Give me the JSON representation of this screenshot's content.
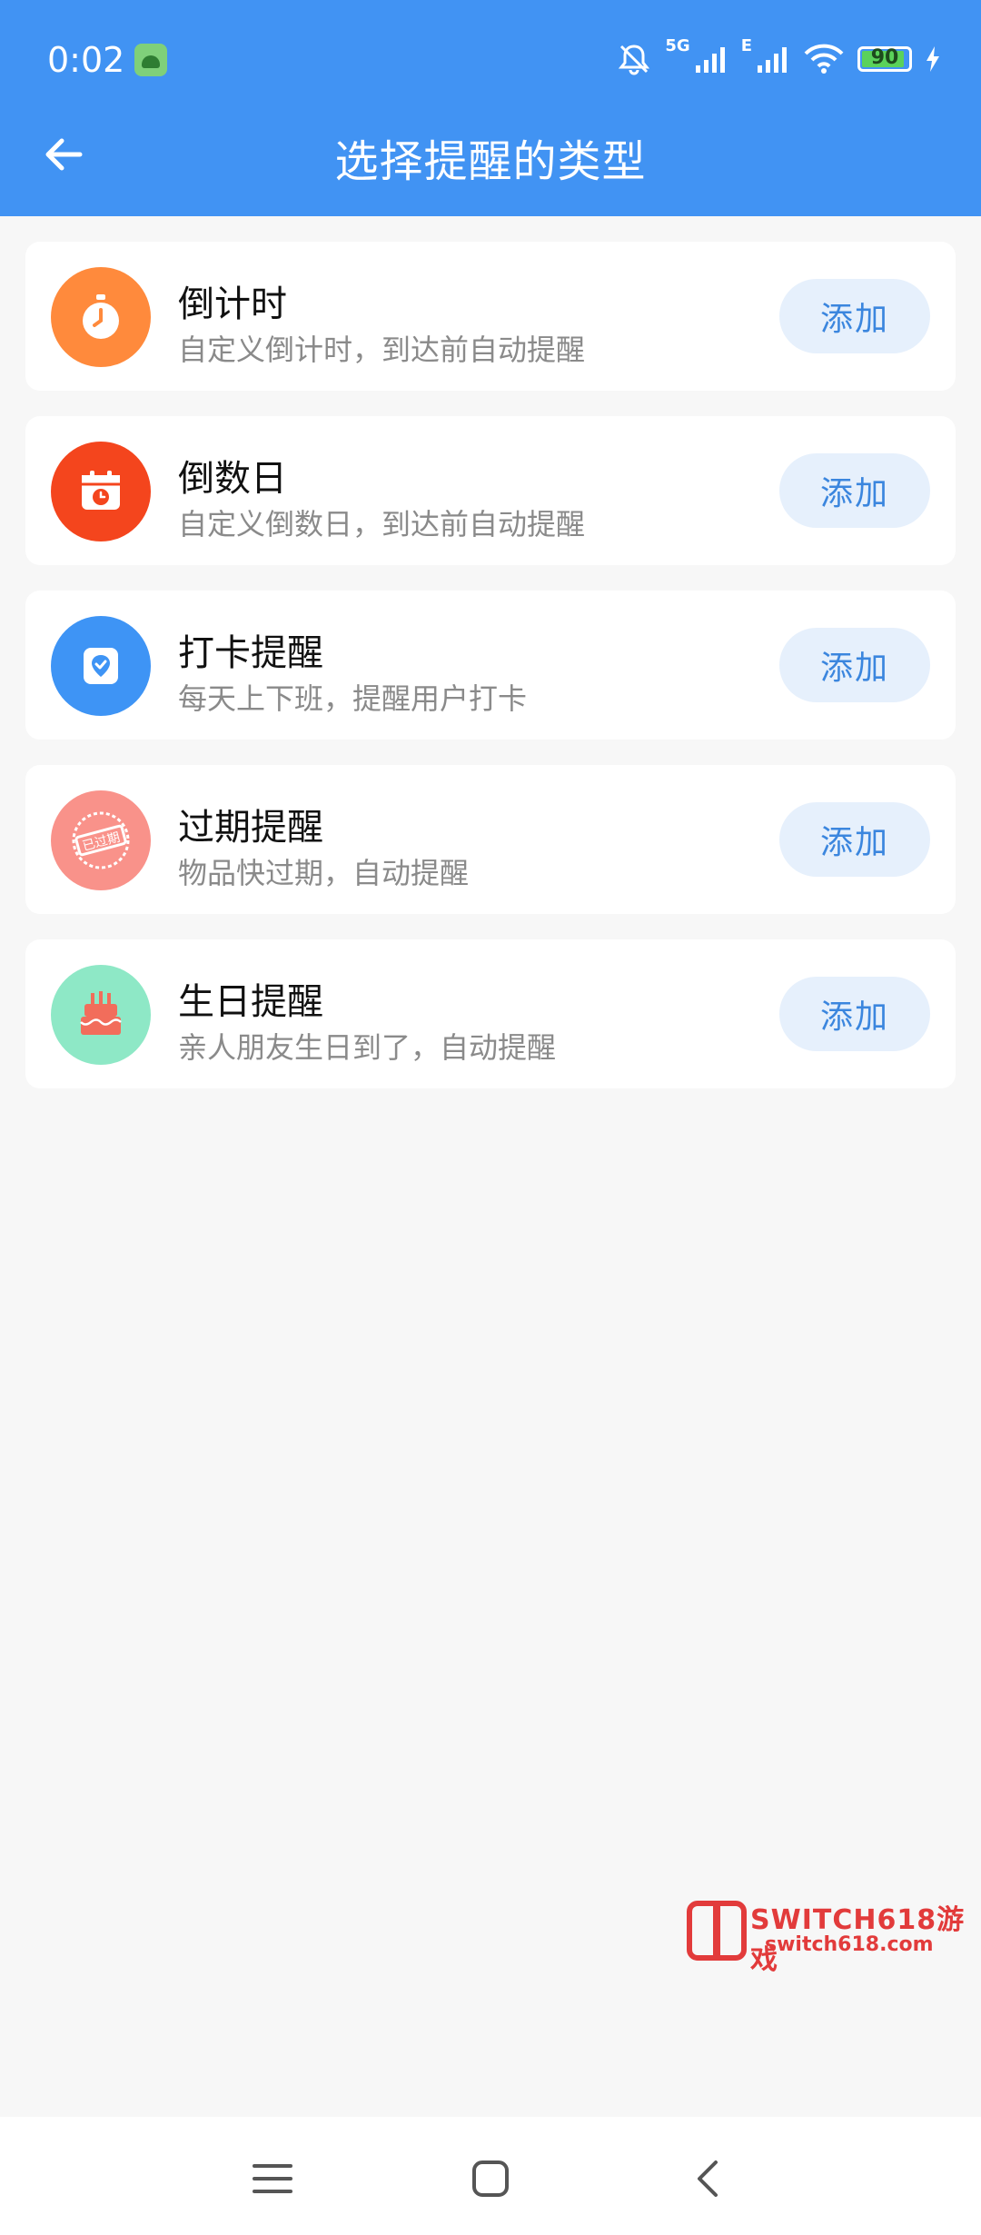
{
  "status_bar": {
    "time": "0:02",
    "network_label": "5G",
    "network2_label": "E",
    "battery": "90",
    "icons": [
      "android-app-icon",
      "bell-muted-icon",
      "signal-icon",
      "wifi-icon",
      "battery-icon",
      "charging-icon"
    ]
  },
  "header": {
    "title": "选择提醒的类型",
    "back_icon": "arrow-left-icon",
    "background": "#4193f3"
  },
  "reminder_types": [
    {
      "title": "倒计时",
      "description": "自定义倒计时，到达前自动提醒",
      "button": "添加",
      "icon": "stopwatch-icon",
      "color": "#ff8a3c"
    },
    {
      "title": "倒数日",
      "description": "自定义倒数日，到达前自动提醒",
      "button": "添加",
      "icon": "calendar-clock-icon",
      "color": "#f4451d"
    },
    {
      "title": "打卡提醒",
      "description": "每天上下班，提醒用户打卡",
      "button": "添加",
      "icon": "location-checkin-icon",
      "color": "#3e94f5"
    },
    {
      "title": "过期提醒",
      "description": "物品快过期，自动提醒",
      "button": "添加",
      "icon": "expired-stamp-icon",
      "color": "#f9928a"
    },
    {
      "title": "生日提醒",
      "description": "亲人朋友生日到了，自动提醒",
      "button": "添加",
      "icon": "birthday-cake-icon",
      "color": "#8ee8c6"
    }
  ],
  "expired_stamp_text": "已过期",
  "watermark": {
    "line1": "SWITCH618游戏",
    "line2": "switch618.com",
    "color": "#e23b3b"
  },
  "nav": {
    "icons": [
      "menu-icon",
      "home-square-icon",
      "back-chevron-icon"
    ]
  },
  "colors": {
    "accent": "#4193f3",
    "button_bg": "#e6f0fc",
    "button_text": "#3b86de",
    "page_bg": "#f7f7f7"
  }
}
